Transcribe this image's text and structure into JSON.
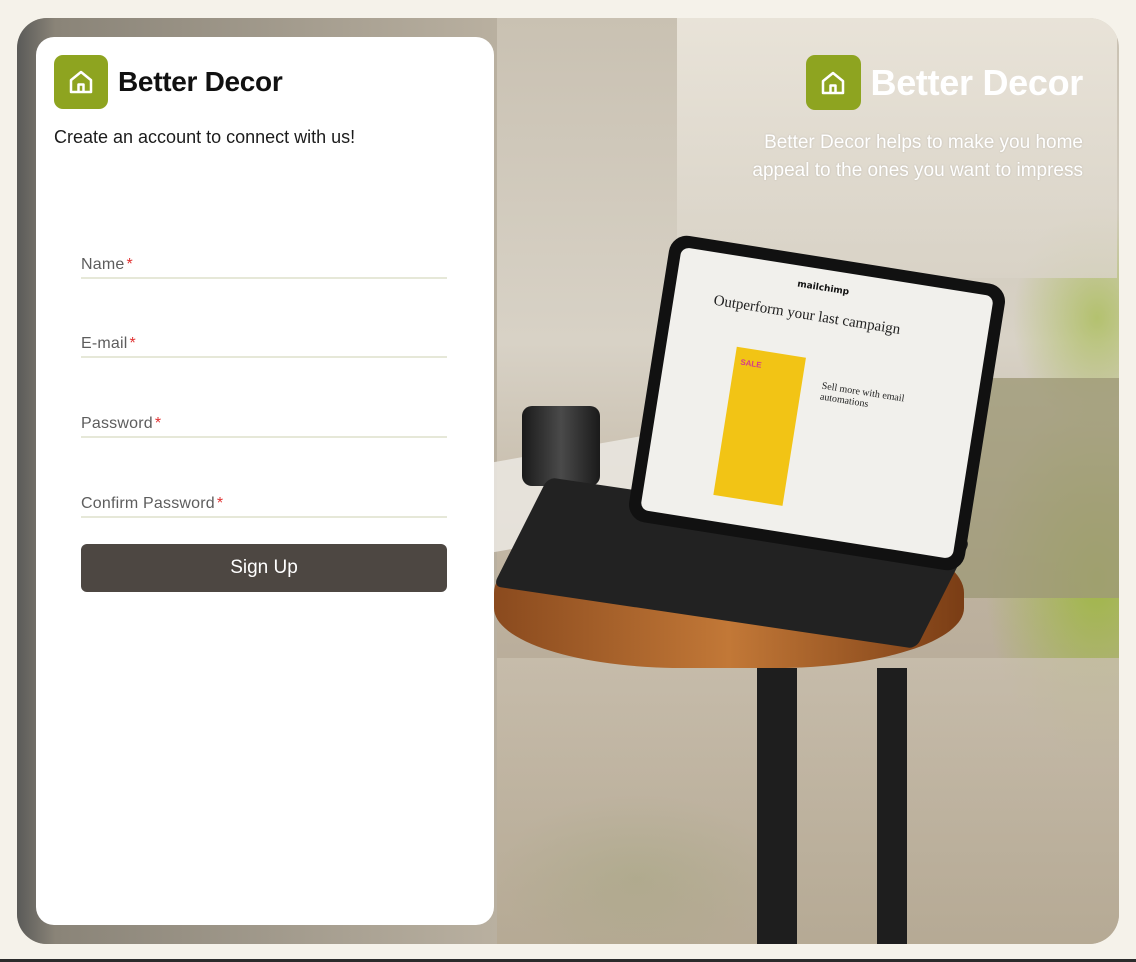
{
  "card": {
    "brand_name": "Better Decor",
    "brand_icon": "home-icon",
    "tagline": "Create an account to connect with us!"
  },
  "form": {
    "fields": [
      {
        "label": "Name",
        "required_mark": "*"
      },
      {
        "label": "E-mail",
        "required_mark": "*"
      },
      {
        "label": "Password",
        "required_mark": "*"
      },
      {
        "label": "Confirm Password",
        "required_mark": "*"
      }
    ],
    "submit_label": "Sign Up"
  },
  "hero": {
    "brand_name": "Better Decor",
    "brand_icon": "home-icon",
    "description": "Better Decor helps to make you home appeal to the ones you want to impress"
  },
  "tablet_screen": {
    "logo": "mailchimp",
    "headline": "Outperform your last campaign",
    "promo": "SALE",
    "subhead": "Sell more with email automations"
  },
  "colors": {
    "accent": "#8ea420",
    "button": "#4d4742",
    "required": "#e03030"
  }
}
